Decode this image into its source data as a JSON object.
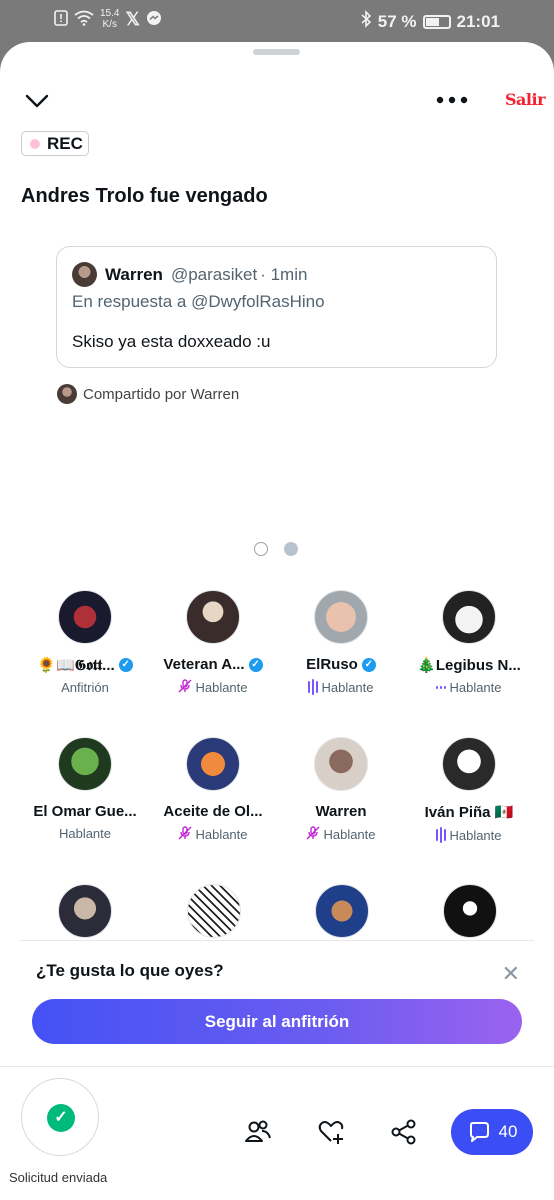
{
  "status_bar": {
    "speed_value": "15.4",
    "speed_unit": "K/s",
    "battery": "57 %",
    "battery_level": 0.57,
    "time": "21:01"
  },
  "header": {
    "exit_label": "Salir",
    "rec_label": "REC"
  },
  "space": {
    "title": "Andres Trolo fue vengado"
  },
  "tweet": {
    "name": "Warren",
    "handle": "@parasiket",
    "time": "· 1min",
    "reply_to": "En respuesta a @DwyfolRasHino",
    "text": "Skiso ya esta doxxeado :u",
    "shared_by": "Compartido por Warren"
  },
  "speakers": [
    {
      "name": "🌻📖𝕲𝖔𝖙𝖙...",
      "role": "Anfitrión",
      "verified": true,
      "status": "none"
    },
    {
      "name": "Veteran A...",
      "role": "Hablante",
      "verified": true,
      "status": "muted"
    },
    {
      "name": "ElRuso",
      "role": "Hablante",
      "verified": true,
      "status": "speaking"
    },
    {
      "name": "🎄Legibus N...",
      "role": "Hablante",
      "verified": false,
      "status": "idle"
    },
    {
      "name": "El Omar Gue...",
      "role": "Hablante",
      "verified": false,
      "status": "none"
    },
    {
      "name": "Aceite de Ol...",
      "role": "Hablante",
      "verified": false,
      "status": "muted"
    },
    {
      "name": "Warren",
      "role": "Hablante",
      "verified": false,
      "status": "muted"
    },
    {
      "name": "Iván Piña 🇲🇽",
      "role": "Hablante",
      "verified": false,
      "status": "speaking"
    }
  ],
  "prompt": {
    "question": "¿Te gusta lo que oyes?",
    "follow_label": "Seguir al anfitrión"
  },
  "bottom": {
    "request_label": "Solicitud enviada",
    "comment_count": "40"
  }
}
